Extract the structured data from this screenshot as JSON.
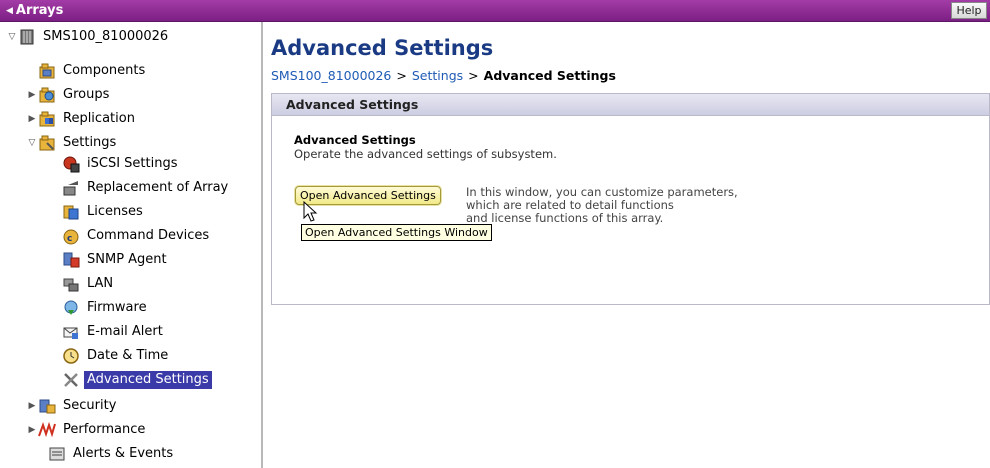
{
  "topbar": {
    "back_label": "Arrays",
    "help_label": "Help"
  },
  "sidebar": {
    "items": [
      {
        "label": "SMS100_81000026",
        "icon": "storage-array-icon",
        "expander": "expanded"
      },
      {
        "label": "Components",
        "icon": "components-icon",
        "expander": "none"
      },
      {
        "label": "Groups",
        "icon": "groups-icon",
        "expander": "collapsed"
      },
      {
        "label": "Replication",
        "icon": "replication-icon",
        "expander": "collapsed"
      },
      {
        "label": "Settings",
        "icon": "settings-icon",
        "expander": "expanded"
      },
      {
        "label": "iSCSI Settings",
        "icon": "iscsi-icon",
        "expander": "none"
      },
      {
        "label": "Replacement of Array",
        "icon": "replacement-icon",
        "expander": "none"
      },
      {
        "label": "Licenses",
        "icon": "licenses-icon",
        "expander": "none"
      },
      {
        "label": "Command Devices",
        "icon": "command-devices-icon",
        "expander": "none"
      },
      {
        "label": "SNMP Agent",
        "icon": "snmp-icon",
        "expander": "none"
      },
      {
        "label": "LAN",
        "icon": "lan-icon",
        "expander": "none"
      },
      {
        "label": "Firmware",
        "icon": "firmware-icon",
        "expander": "none"
      },
      {
        "label": "E-mail Alert",
        "icon": "email-alert-icon",
        "expander": "none"
      },
      {
        "label": "Date & Time",
        "icon": "clock-icon",
        "expander": "none"
      },
      {
        "label": "Advanced Settings",
        "icon": "tools-icon",
        "expander": "none",
        "selected": true
      },
      {
        "label": "Security",
        "icon": "security-icon",
        "expander": "collapsed"
      },
      {
        "label": "Performance",
        "icon": "performance-icon",
        "expander": "collapsed"
      },
      {
        "label": "Alerts & Events",
        "icon": "alerts-icon",
        "expander": "none"
      }
    ]
  },
  "main": {
    "title": "Advanced Settings",
    "breadcrumb": {
      "root": "SMS100_81000026",
      "parent": "Settings",
      "current": "Advanced Settings",
      "separator": ">"
    },
    "panel": {
      "header": "Advanced Settings",
      "section_title": "Advanced Settings",
      "section_desc": "Operate the advanced settings of subsystem.",
      "open_button_label": "Open Advanced Settings",
      "help_lines": [
        "In this window, you can customize parameters,",
        "which are related to detail functions",
        "and license functions of this array."
      ],
      "tooltip": "Open Advanced Settings Window"
    }
  },
  "colors": {
    "topbar": "#8a2a93",
    "title": "#1a3b84",
    "link": "#1f5bb5",
    "selected": "#3a3aa8",
    "button": "#f2e98a"
  }
}
